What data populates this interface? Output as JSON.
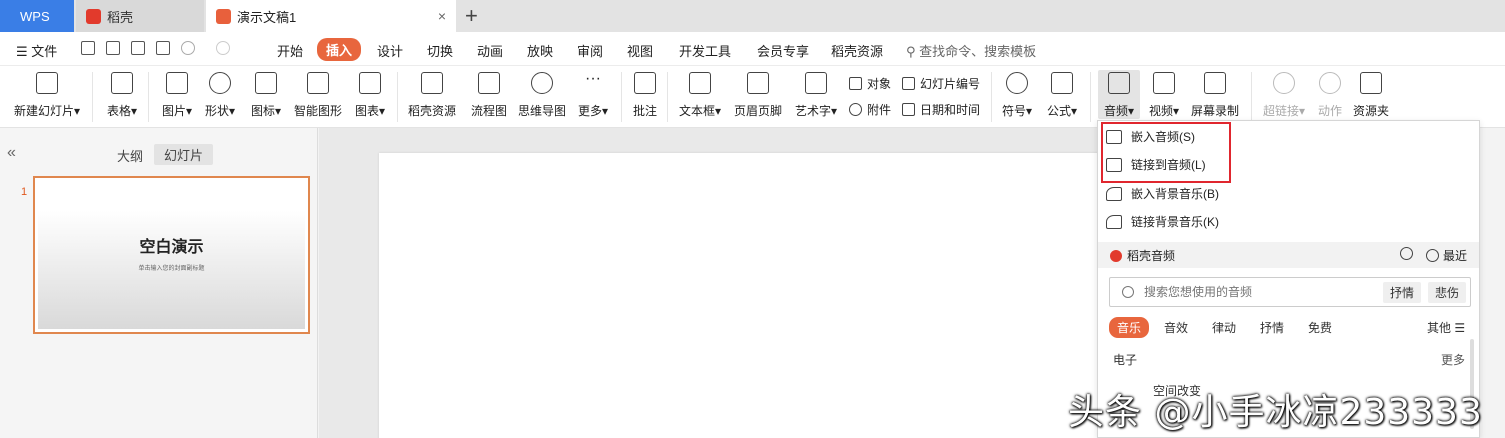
{
  "tabs": {
    "wps": "WPS",
    "daoke": "稻壳",
    "doc": "演示文稿1",
    "close": "×",
    "add": "+"
  },
  "menu": {
    "file": "☰ 文件",
    "items": [
      "开始",
      "插入",
      "设计",
      "切换",
      "动画",
      "放映",
      "审阅",
      "视图",
      "开发工具",
      "会员专享",
      "稻壳资源"
    ],
    "search": "查找命令、搜索模板"
  },
  "ribbon": {
    "new_slide": "新建幻灯片",
    "table": "表格",
    "picture": "图片",
    "shape": "形状",
    "icon": "图标",
    "smart_graphic": "智能图形",
    "chart": "图表",
    "daoke_res": "稻壳资源",
    "flowchart": "流程图",
    "mindmap": "思维导图",
    "more": "更多",
    "comment": "批注",
    "textbox": "文本框",
    "header_footer": "页眉页脚",
    "wordart": "艺术字",
    "object": "对象",
    "attachment": "附件",
    "slide_number": "幻灯片编号",
    "date_time": "日期和时间",
    "symbol": "符号",
    "formula": "公式",
    "audio": "音频",
    "video": "视频",
    "screen_record": "屏幕录制",
    "hyperlink": "超链接",
    "action": "动作",
    "resource": "资源夹",
    "caret": "▾"
  },
  "left_panel": {
    "collapse": "«",
    "outline": "大纲",
    "slides": "幻灯片",
    "slide_number": "1",
    "thumb_title": "空白演示",
    "thumb_sub": "单击输入您的封面副标题"
  },
  "audio_menu": {
    "embed_audio": "嵌入音频(S)",
    "link_audio": "链接到音频(L)",
    "embed_bg": "嵌入背景音乐(B)",
    "link_bg": "链接背景音乐(K)",
    "section_title": "稻壳音频",
    "recent": "最近",
    "search_placeholder": "搜索您想使用的音频",
    "chip1": "抒情",
    "chip2": "悲伤",
    "categories": [
      "音乐",
      "音效",
      "律动",
      "抒情",
      "免费"
    ],
    "other": "其他 ☰",
    "group": "电子",
    "more": "更多",
    "song": "空间改变"
  },
  "watermark": "头条 @小手冰凉233333",
  "colors": {
    "accent": "#e8663d",
    "wps_blue": "#3a7ee6",
    "highlight": "#e0262e"
  }
}
